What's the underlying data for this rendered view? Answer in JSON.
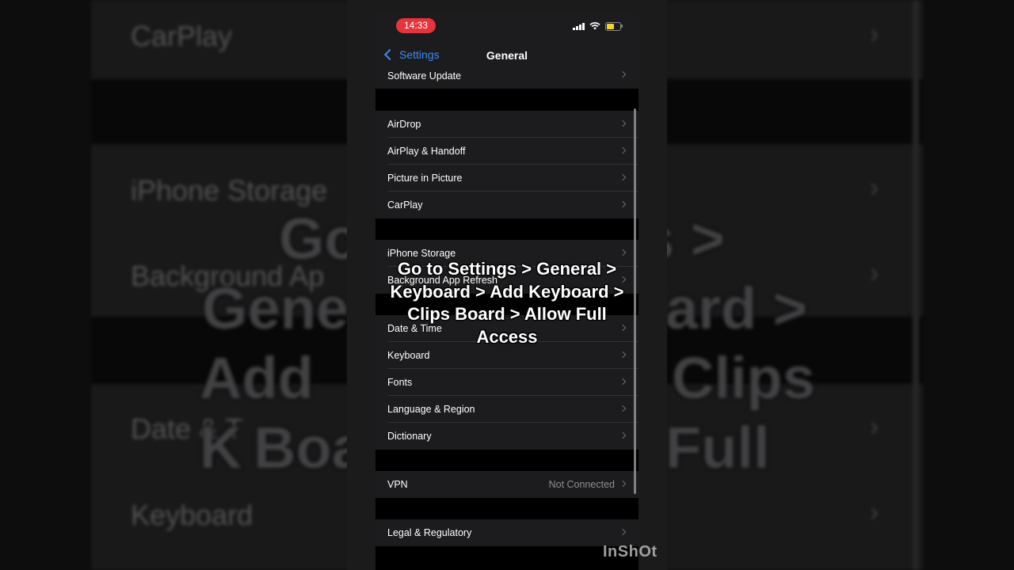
{
  "status_bar": {
    "time": "14:33"
  },
  "nav": {
    "back_label": "Settings",
    "title": "General"
  },
  "groups": [
    {
      "rows": [
        {
          "label": "Software Update"
        }
      ]
    },
    {
      "rows": [
        {
          "label": "AirDrop"
        },
        {
          "label": "AirPlay & Handoff"
        },
        {
          "label": "Picture in Picture"
        },
        {
          "label": "CarPlay"
        }
      ]
    },
    {
      "rows": [
        {
          "label": "iPhone Storage"
        },
        {
          "label": "Background App Refresh"
        }
      ]
    },
    {
      "rows": [
        {
          "label": "Date & Time"
        },
        {
          "label": "Keyboard"
        },
        {
          "label": "Fonts"
        },
        {
          "label": "Language & Region"
        },
        {
          "label": "Dictionary"
        }
      ]
    },
    {
      "rows": [
        {
          "label": "VPN",
          "detail": "Not Connected"
        }
      ]
    },
    {
      "rows": [
        {
          "label": "Legal & Regulatory"
        }
      ]
    }
  ],
  "overlay_caption": "Go to Settings > General > Keyboard > Add Keyboard > Clips Board > Allow Full Access",
  "watermark": "InShOt",
  "background": {
    "rows": [
      "CarPlay",
      "iPhone Storage",
      "Background Ap",
      "Date & T",
      "Keyboard"
    ],
    "caption_lines": [
      "Go",
      "s >",
      "Gene",
      "ard >",
      "Add K",
      "Clips",
      "Boa",
      "Full"
    ]
  },
  "colors": {
    "accent": "#3f8cf2",
    "time_pill": "#e5343b",
    "battery": "#f5d130"
  }
}
